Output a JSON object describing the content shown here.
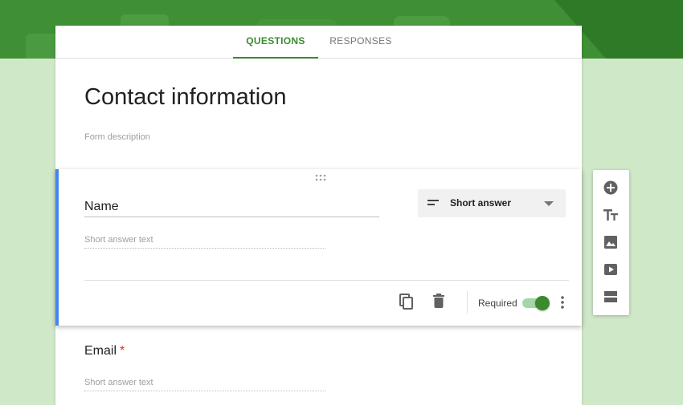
{
  "tabs": [
    {
      "label": "QUESTIONS",
      "active": true
    },
    {
      "label": "RESPONSES",
      "active": false
    }
  ],
  "form": {
    "title": "Contact information",
    "description_placeholder": "Form description"
  },
  "questions": [
    {
      "title": "Name",
      "type": "Short answer",
      "answer_placeholder": "Short answer text",
      "required_label": "Required",
      "required": true
    },
    {
      "title": "Email",
      "required_marker": "*",
      "answer_placeholder": "Short answer text"
    }
  ],
  "side_toolbar": [
    "add-question-icon",
    "add-title-icon",
    "add-image-icon",
    "add-video-icon",
    "add-section-icon"
  ],
  "colors": {
    "accent": "#3a8a2e",
    "header_band": "#3f8f35",
    "background": "#cfe8c8",
    "active_card_border": "#4285f4",
    "required_star": "#d93025"
  }
}
